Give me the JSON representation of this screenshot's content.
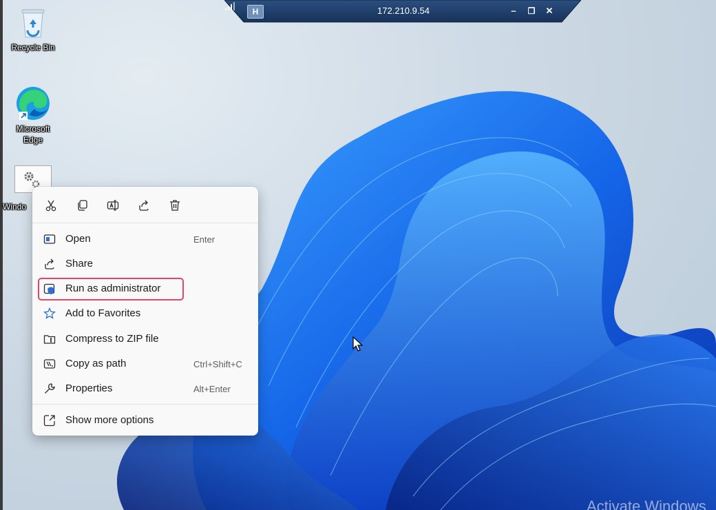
{
  "rdp_bar": {
    "title": "172.210.9.54",
    "pin_label": "H",
    "minimize_glyph": "–",
    "restore_glyph": "❐",
    "close_glyph": "✕"
  },
  "desktop_icons": [
    {
      "label": "Recycle Bin",
      "icon": "recycle-bin-icon"
    },
    {
      "label": "Microsoft Edge",
      "icon": "edge-icon"
    },
    {
      "label": "Windo",
      "icon": "settings-gear-icon"
    }
  ],
  "context_menu": {
    "quick_actions": [
      {
        "name": "cut",
        "icon": "scissors-icon"
      },
      {
        "name": "copy",
        "icon": "copy-icon"
      },
      {
        "name": "rename",
        "icon": "rename-icon"
      },
      {
        "name": "share",
        "icon": "share-icon"
      },
      {
        "name": "delete",
        "icon": "trash-icon"
      }
    ],
    "items": [
      {
        "label": "Open",
        "shortcut": "Enter",
        "icon": "open-window-icon"
      },
      {
        "label": "Share",
        "shortcut": "",
        "icon": "share-icon"
      },
      {
        "label": "Run as administrator",
        "shortcut": "",
        "icon": "shield-icon",
        "highlighted": true
      },
      {
        "label": "Add to Favorites",
        "shortcut": "",
        "icon": "star-icon"
      },
      {
        "label": "Compress to ZIP file",
        "shortcut": "",
        "icon": "zip-icon"
      },
      {
        "label": "Copy as path",
        "shortcut": "Ctrl+Shift+C",
        "icon": "copy-path-icon"
      },
      {
        "label": "Properties",
        "shortcut": "Alt+Enter",
        "icon": "wrench-icon"
      },
      {
        "label": "Show more options",
        "shortcut": "",
        "icon": "more-options-icon"
      }
    ],
    "highlight_color": "#e0466a"
  },
  "watermark": "Activate Windows",
  "colors": {
    "accent": "#1e6ff0",
    "rdp_bar": "#1f3d66"
  }
}
